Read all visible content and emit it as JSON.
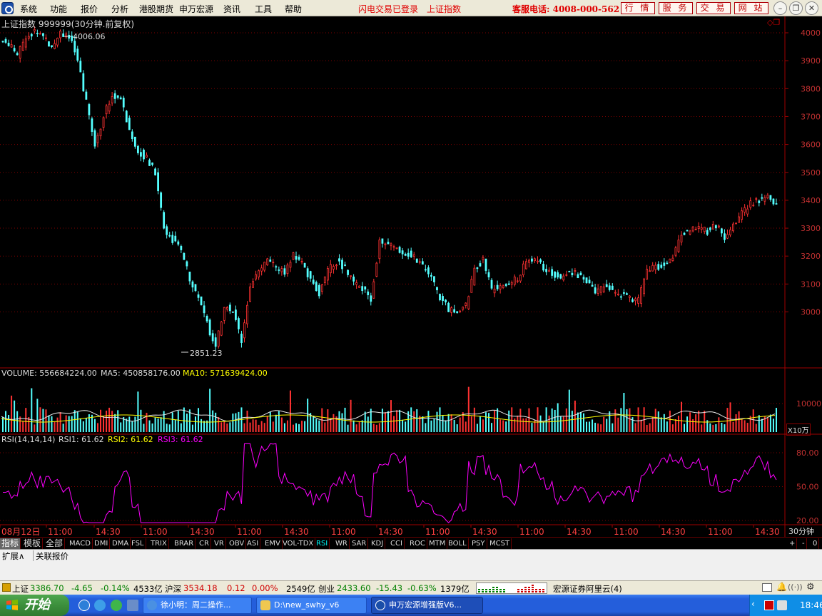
{
  "menubar": {
    "items": [
      "系统",
      "功能",
      "报价",
      "分析",
      "港股期货",
      "申万宏源",
      "资讯",
      "工具",
      "帮助"
    ],
    "status_login": "闪电交易已登录",
    "status_index": "上证指数",
    "hotline": "客服电话: 4008-000-562",
    "buttons": [
      "行 情",
      "服 务",
      "交 易",
      "网 站"
    ]
  },
  "chart": {
    "title": "上证指数 999999(30分钟.前复权)",
    "high_label": "4006.06",
    "low_label": "2851.23",
    "y_ticks": [
      "4000",
      "3900",
      "3800",
      "3700",
      "3600",
      "3500",
      "3400",
      "3300",
      "3200",
      "3100",
      "3000"
    ],
    "volume_label": "VOLUME: 556684224.00",
    "ma5_label": "MA5: 450858176.00",
    "ma10_label": "MA10: 571639424.00",
    "vol_tick": "10000",
    "vol_unit": "X10万",
    "rsi_label": "RSI(14,14,14)",
    "rsi1_label": "RSI1: 61.62",
    "rsi2_label": "RSI2: 61.62",
    "rsi3_label": "RSI3: 61.62",
    "rsi_ticks": [
      "80.00",
      "50.00",
      "20.00"
    ],
    "x_labels": [
      "08月12日",
      "11:00",
      "14:30",
      "11:00",
      "14:30",
      "11:00",
      "14:30",
      "11:00",
      "14:30",
      "11:00",
      "14:30",
      "11:00",
      "14:30",
      "11:00",
      "14:30",
      "11:00",
      "14:30"
    ],
    "period": "30分钟"
  },
  "chart_data": {
    "type": "candlestick",
    "title": "上证指数 999999(30分钟.前复权)",
    "y_range": [
      2851.23,
      4006.06
    ],
    "close_path": [
      3960,
      3920,
      3980,
      4006,
      3990,
      3950,
      4000,
      3990,
      3900,
      3750,
      3600,
      3700,
      3780,
      3760,
      3650,
      3580,
      3550,
      3500,
      3300,
      3260,
      3220,
      3120,
      3050,
      2960,
      2870,
      3020,
      3000,
      2900,
      3100,
      3150,
      3180,
      3160,
      3140,
      3200,
      3180,
      3110,
      3070,
      3150,
      3180,
      3160,
      3100,
      3080,
      3050,
      3250,
      3240,
      3230,
      3210,
      3200,
      3160,
      3120,
      3050,
      3010,
      3000,
      3020,
      3150,
      3190,
      3080,
      3090,
      3100,
      3120,
      3180,
      3190,
      3160,
      3140,
      3120,
      3150,
      3130,
      3110,
      3070,
      3090,
      3080,
      3060,
      3050,
      3040,
      3150,
      3160,
      3170,
      3200,
      3280,
      3290,
      3300,
      3290,
      3310,
      3270,
      3310,
      3350,
      3390,
      3400,
      3410,
      3380
    ],
    "rsi_current": 61.62,
    "volume_current": 556684224.0,
    "ma5": 450858176.0,
    "ma10": 571639424.0
  },
  "indicator_tabs": [
    "指标",
    "模板",
    "全部",
    "MACD",
    "DMI",
    "DMA",
    "FSL",
    "TRIX",
    "BRAR",
    "CR",
    "VR",
    "OBV",
    "ASI",
    "EMV",
    "VOL-TDX",
    "RSI",
    "WR",
    "SAR",
    "KDJ",
    "CCI",
    "ROC",
    "MTM",
    "BOLL",
    "PSY",
    "MCST"
  ],
  "ext_tabs": [
    "扩展∧",
    "关联报价"
  ],
  "statusbar": {
    "sh_label": "上证",
    "sh_val": "3386.70",
    "sh_chg": "-4.65",
    "sh_pct": "-0.14%",
    "sh_amt": "4533亿",
    "hs_label": "沪深",
    "hs_val": "3534.18",
    "hs_chg": "0.12",
    "hs_pct": "0.00%",
    "hs_amt": "2549亿",
    "cy_label": "创业",
    "cy_val": "2433.60",
    "cy_chg": "-15.43",
    "cy_pct": "-0.63%",
    "cy_amt": "1379亿",
    "server": "宏源证券阿里云(4)"
  },
  "taskbar": {
    "start": "开始",
    "tasks": [
      "徐小明：周二操作...",
      "D:\\new_swhy_v6",
      "申万宏源增强版V6..."
    ],
    "clock": "18:46"
  }
}
